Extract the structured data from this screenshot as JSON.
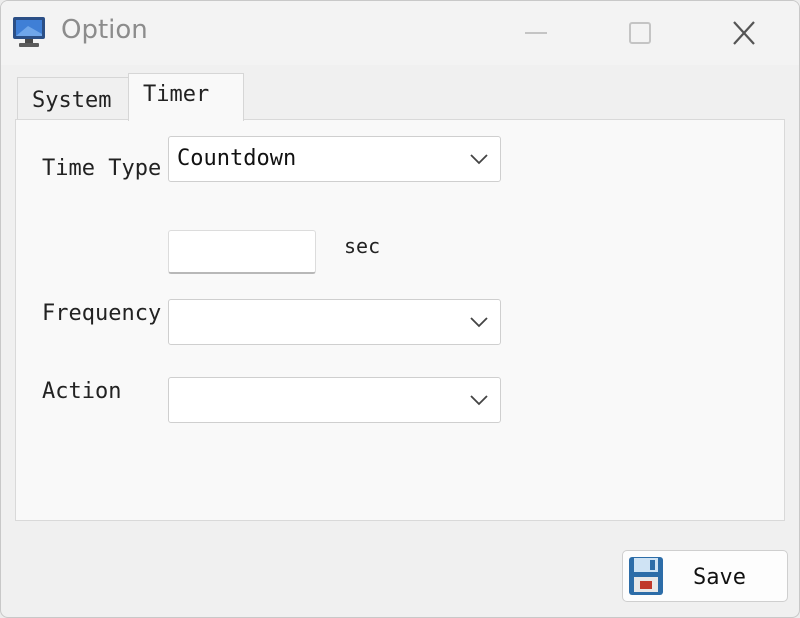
{
  "window": {
    "title": "Option",
    "controls": [
      "minimize-icon",
      "maximize-icon",
      "close-icon"
    ]
  },
  "tabs": [
    {
      "label": "System",
      "active": false
    },
    {
      "label": "Timer",
      "active": true
    }
  ],
  "form": {
    "time_type": {
      "label": "Time Type",
      "value": "Countdown"
    },
    "seconds": {
      "value": "",
      "unit": "sec"
    },
    "frequency": {
      "label": "Frequency",
      "value": ""
    },
    "action": {
      "label": "Action",
      "value": ""
    }
  },
  "buttons": {
    "save_label": "Save"
  },
  "icons": {
    "app": "monitor-icon",
    "save": "floppy-disk-icon",
    "dropdown": "chevron-down-icon"
  },
  "colors": {
    "window_bg": "#f0f0f0",
    "panel_bg": "#f9f9f9",
    "title_text": "#8c8c8c"
  }
}
